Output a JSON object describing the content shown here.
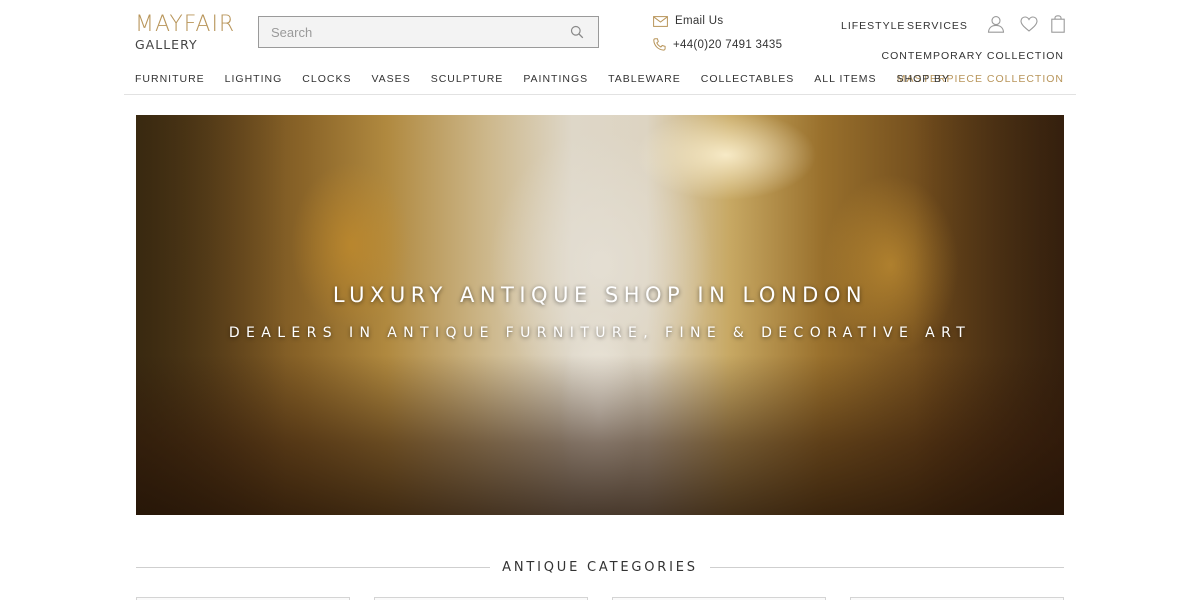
{
  "brand": {
    "name": "MAYFAIR",
    "sub": "GALLERY",
    "accent_color": "#b8955a"
  },
  "search": {
    "placeholder": "Search",
    "value": ""
  },
  "contact": {
    "email_label": "Email Us",
    "phone": "+44(0)20 7491 3435"
  },
  "utility_nav": {
    "lifestyle": "LIFESTYLE",
    "services": "SERVICES"
  },
  "collections": {
    "contemporary": "CONTEMPORARY COLLECTION",
    "masterpiece": "MASTERPIECE COLLECTION"
  },
  "main_nav": [
    {
      "label": "FURNITURE"
    },
    {
      "label": "LIGHTING"
    },
    {
      "label": "CLOCKS"
    },
    {
      "label": "VASES"
    },
    {
      "label": "SCULPTURE"
    },
    {
      "label": "PAINTINGS"
    },
    {
      "label": "TABLEWARE"
    },
    {
      "label": "COLLECTABLES"
    },
    {
      "label": "ALL ITEMS"
    },
    {
      "label": "SHOP BY"
    }
  ],
  "hero": {
    "title": "LUXURY ANTIQUE SHOP IN LONDON",
    "subtitle": "DEALERS IN ANTIQUE FURNITURE, FINE & DECORATIVE ART"
  },
  "categories": {
    "heading": "ANTIQUE CATEGORIES"
  },
  "icons": {
    "search": "search-icon",
    "email": "envelope-icon",
    "phone": "phone-icon",
    "account": "user-icon",
    "wishlist": "heart-icon",
    "cart": "shopping-bag-icon"
  }
}
